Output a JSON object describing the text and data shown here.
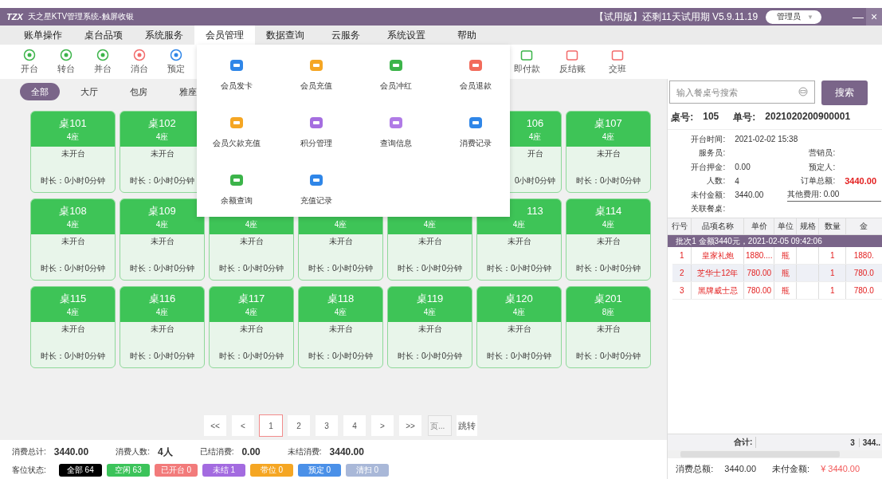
{
  "window": {
    "logo": "TZX",
    "title": "天之星KTV管理系统-触屏收银",
    "trial": "【试用版】还剩11天试用期 V5.9.11.19",
    "user": "管理员",
    "user_caret": "▼",
    "minimize": "—",
    "close": "×"
  },
  "menu": [
    {
      "label": "账单操作",
      "selected": false
    },
    {
      "label": "桌台品项",
      "selected": false
    },
    {
      "label": "系统服务",
      "selected": false
    },
    {
      "label": "会员管理",
      "selected": true
    },
    {
      "label": "数据查询",
      "selected": false
    },
    {
      "label": "云服务",
      "selected": false
    },
    {
      "label": "系统设置",
      "selected": false
    },
    {
      "label": "帮助",
      "selected": false
    }
  ],
  "dropdown": [
    {
      "label": "会员发卡",
      "color": "#2f86e8"
    },
    {
      "label": "会员充值",
      "color": "#f5a623"
    },
    {
      "label": "会员冲红",
      "color": "#3cb44a"
    },
    {
      "label": "会员退款",
      "color": "#f26b5b"
    },
    {
      "label": "会员欠款充值",
      "color": "#f5a623"
    },
    {
      "label": "积分管理",
      "color": "#a56ee0"
    },
    {
      "label": "查询信息",
      "color": "#b07be6"
    },
    {
      "label": "消费记录",
      "color": "#2f86e8"
    },
    {
      "label": "余额查询",
      "color": "#3cb44a"
    },
    {
      "label": "充值记录",
      "color": "#2f86e8"
    }
  ],
  "toolbar_left": [
    {
      "label": "开台",
      "color": "#3cb44a"
    },
    {
      "label": "转台",
      "color": "#3cb44a"
    },
    {
      "label": "并台",
      "color": "#3cb44a"
    },
    {
      "label": "消台",
      "color": "#f26b6b"
    },
    {
      "label": "预定",
      "color": "#2f86e8"
    }
  ],
  "toolbar_right": [
    {
      "label": "即付款",
      "color": "#3cb44a"
    },
    {
      "label": "反结账",
      "color": "#f26b6b"
    },
    {
      "label": "交班",
      "color": "#f26b6b"
    }
  ],
  "areas": [
    {
      "label": "全部",
      "selected": true
    },
    {
      "label": "大厅",
      "selected": false
    },
    {
      "label": "包房",
      "selected": false
    },
    {
      "label": "雅座",
      "selected": false
    }
  ],
  "tables": [
    [
      {
        "name": "桌101",
        "seats": "4座",
        "status": "未开台",
        "duration": "时长：0小时0分钟"
      },
      {
        "name": "桌102",
        "seats": "4座",
        "status": "未开台",
        "duration": "时长：0小时0分钟"
      },
      {
        "name": "106",
        "seats": "4座",
        "status": "开台",
        "duration": "0小时0分钟"
      },
      {
        "name": "桌107",
        "seats": "4座",
        "status": "未开台",
        "duration": "时长：0小时0分钟"
      }
    ],
    [
      {
        "name": "桌108",
        "seats": "4座",
        "status": "未开台",
        "duration": "时长：0小时0分钟"
      },
      {
        "name": "桌109",
        "seats": "4座",
        "status": "未开台",
        "duration": "时长：0小时0分钟"
      },
      {
        "seats": "4座",
        "status": "未开台",
        "duration": "时长：0小时0分钟"
      },
      {
        "seats": "4座",
        "status": "未开台",
        "duration": "时长：0小时0分钟"
      },
      {
        "seats": "4座",
        "status": "未开台",
        "duration": "时长：0小时0分钟"
      },
      {
        "name": "113",
        "seats": "4座",
        "status": "未开台",
        "duration": "时长：0小时0分钟"
      },
      {
        "name": "桌114",
        "seats": "4座",
        "status": "未开台",
        "duration": "时长：0小时0分钟"
      }
    ],
    [
      {
        "name": "桌115",
        "seats": "4座",
        "status": "未开台",
        "duration": "时长：0小时0分钟"
      },
      {
        "name": "桌116",
        "seats": "4座",
        "status": "未开台",
        "duration": "时长：0小时0分钟"
      },
      {
        "name": "桌117",
        "seats": "4座",
        "status": "未开台",
        "duration": "时长：0小时0分钟"
      },
      {
        "name": "桌118",
        "seats": "4座",
        "status": "未开台",
        "duration": "时长：0小时0分钟"
      },
      {
        "name": "桌119",
        "seats": "4座",
        "status": "未开台",
        "duration": "时长：0小时0分钟"
      },
      {
        "name": "桌120",
        "seats": "4座",
        "status": "未开台",
        "duration": "时长：0小时0分钟"
      },
      {
        "name": "桌201",
        "seats": "8座",
        "status": "未开台",
        "duration": "时长：0小时0分钟"
      }
    ]
  ],
  "pagination": {
    "pages": [
      {
        "label": "<<",
        "selected": false
      },
      {
        "label": "<",
        "selected": false
      },
      {
        "label": "1",
        "selected": true
      },
      {
        "label": "2",
        "selected": false
      },
      {
        "label": "3",
        "selected": false
      },
      {
        "label": "4",
        "selected": false
      },
      {
        "label": ">",
        "selected": false
      },
      {
        "label": ">>",
        "selected": false
      }
    ],
    "page_placeholder": "页...",
    "jump": "跳转"
  },
  "summary": [
    {
      "label": "消费总计:",
      "value": "3440.00"
    },
    {
      "label": "消费人数:",
      "value": "4人"
    },
    {
      "label": "已结消费:",
      "value": "0.00"
    },
    {
      "label": "未结消费:",
      "value": "3440.00"
    }
  ],
  "status_legend": {
    "label": "客位状态:",
    "items": [
      {
        "label": "全部 64",
        "color": "#000000"
      },
      {
        "label": "空闲 63",
        "color": "#3cc35a"
      },
      {
        "label": "已开台 0",
        "color": "#f27b7b"
      },
      {
        "label": "未结 1",
        "color": "#a36be0"
      },
      {
        "label": "带位 0",
        "color": "#f5a623"
      },
      {
        "label": "预定 0",
        "color": "#4a90e8"
      },
      {
        "label": "清扫 0",
        "color": "#a9b8d8"
      }
    ]
  },
  "order": {
    "search_placeholder": "输入餐桌号搜索",
    "search_button": "搜索",
    "table_label": "桌号:",
    "table_no": "105",
    "order_label": "单号:",
    "order_no": "2021020200900001",
    "open_time_label": "开台时间:",
    "open_time": "2021-02-02 15:38",
    "waiter_label": "服务员:",
    "sales_label": "营销员:",
    "deposit_label": "开台押金:",
    "deposit": "0.00",
    "booker_label": "预定人:",
    "people_label": "人数:",
    "people": "4",
    "total_label": "订单总额:",
    "total": "3440.00",
    "unpaid_label": "未付金额:",
    "unpaid": "3440.00",
    "other_fee": "其他费用: 0.00",
    "linked_label": "关联餐桌:",
    "columns": [
      "行号",
      "品项名称",
      "单价",
      "单位",
      "规格",
      "数量",
      "金"
    ],
    "batch": "批次1   金额3440元，2021-02-05 09:42:06",
    "rows": [
      [
        "1",
        "皇家礼炮",
        "1880....",
        "瓶",
        "",
        "1",
        "1880."
      ],
      [
        "2",
        "芝华士12年",
        "780.00",
        "瓶",
        "",
        "1",
        "780.0"
      ],
      [
        "3",
        "黑牌威士忌",
        "780.00",
        "瓶",
        "",
        "1",
        "780.0"
      ]
    ],
    "footer_label": "合计:",
    "footer_qty": "3",
    "footer_amount": "344..",
    "total_consumption_label": "消费总额:",
    "total_consumption": "3440.00",
    "unpaid_footer_label": "未付金额:",
    "unpaid_footer": "¥ 3440.00"
  }
}
